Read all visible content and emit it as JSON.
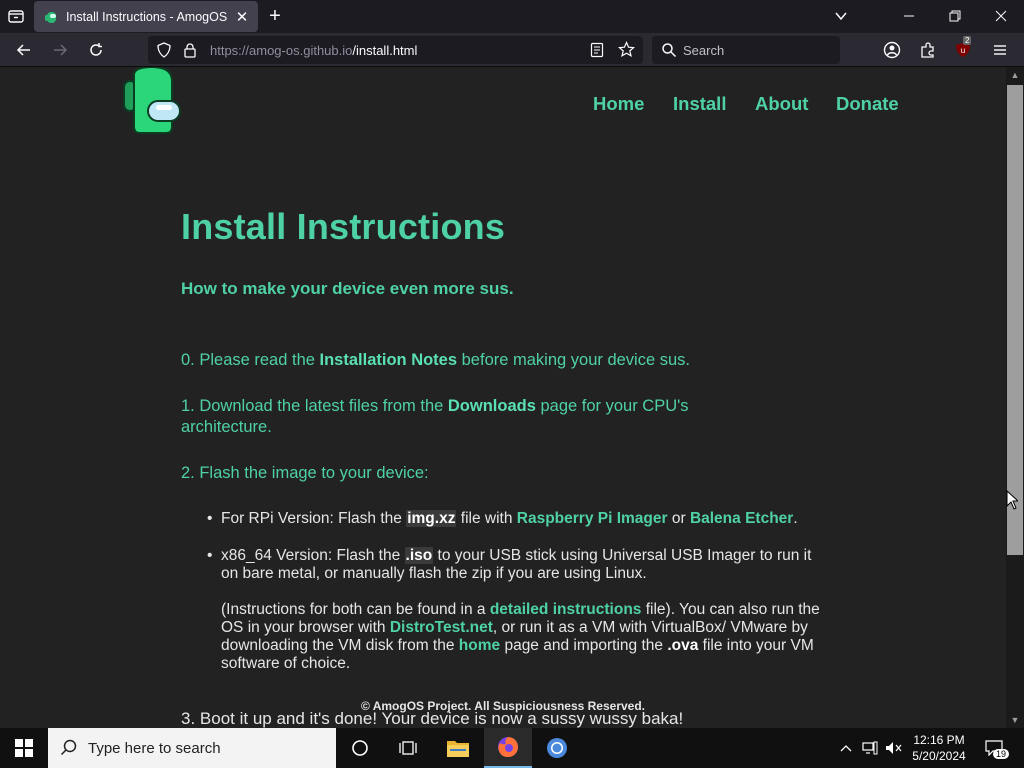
{
  "browser": {
    "tab_title": "Install Instructions - AmogOS",
    "url_host": "https://amog-os.github.io",
    "url_path": "/install.html",
    "search_placeholder": "Search",
    "ublock_badge": "2"
  },
  "site": {
    "nav": [
      "Home",
      "Install",
      "About",
      "Donate"
    ],
    "title": "Install Instructions",
    "subtitle": "How to make your device even more sus.",
    "step0": {
      "pre": "0. Please read the ",
      "link": "Installation Notes",
      "post": " before making your device sus."
    },
    "step1": {
      "pre": "1. Download the latest files from the ",
      "link": "Downloads",
      "post": " page for your CPU's architecture."
    },
    "step2": "2. Flash the image to your device:",
    "bullet_rpi": {
      "pre": "For RPi Version: Flash the ",
      "file": "img.xz",
      "mid": " file with ",
      "link1": "Raspberry Pi Imager",
      "or": " or ",
      "link2": "Balena Etcher",
      "end": "."
    },
    "bullet_x86": {
      "pre": "x86_64 Version: Flash the ",
      "file": ".iso",
      "post": " to your USB stick using Universal USB Imager to run it on bare metal, or manually flash the zip if you are using Linux."
    },
    "note": {
      "p1": "(Instructions for both can be found in a ",
      "link1": "detailed instructions",
      "p2": " file). You can also run the OS in your browser with ",
      "link2": "DistroTest.net",
      "p3": ", or run it as a VM with VirtualBox/ VMware by downloading the VM disk from the ",
      "link3": "home",
      "p4": " page and importing the ",
      "ova": ".ova",
      "p5": " file into your VM software of choice."
    },
    "footer": "© AmogOS Project. All Suspiciousness Reserved.",
    "step3": "3. Boot it up and it's done! Your device is now a sussy wussy baka!"
  },
  "taskbar": {
    "search_placeholder": "Type here to search",
    "time": "12:16 PM",
    "date": "5/20/2024",
    "notif_count": "19"
  },
  "colors": {
    "accent": "#4fd1a6",
    "page_bg": "#222222",
    "chrome_bg": "#1c1b22"
  }
}
